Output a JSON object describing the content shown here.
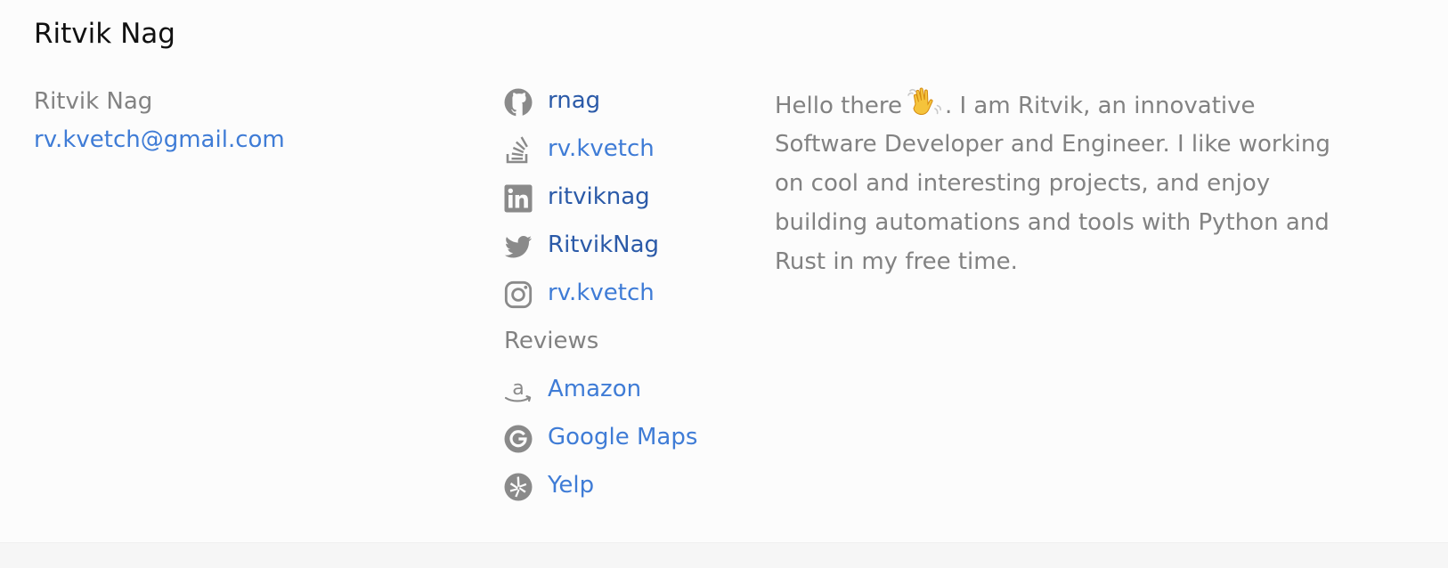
{
  "header": {
    "title": "Ritvik Nag"
  },
  "contact": {
    "name": "Ritvik Nag",
    "email": "rv.kvetch@gmail.com"
  },
  "social": [
    {
      "icon": "github-icon",
      "label": "rnag"
    },
    {
      "icon": "stackoverflow-icon",
      "label": "rv.kvetch"
    },
    {
      "icon": "linkedin-icon",
      "label": "ritviknag"
    },
    {
      "icon": "twitter-icon",
      "label": "RitvikNag"
    },
    {
      "icon": "instagram-icon",
      "label": "rv.kvetch"
    }
  ],
  "reviews": {
    "heading": "Reviews",
    "items": [
      {
        "icon": "amazon-icon",
        "label": "Amazon"
      },
      {
        "icon": "google-icon",
        "label": "Google Maps"
      },
      {
        "icon": "yelp-icon",
        "label": "Yelp"
      }
    ]
  },
  "bio": {
    "lines": [
      "Hello there",
      ". I am Ritvik, an innovative",
      "Software Developer and Engineer. I like working",
      "on cool and interesting projects, and enjoy",
      "building automations and tools with Python and",
      "Rust in my free time."
    ],
    "emoji": "waving-hand-emoji"
  },
  "colors": {
    "link_dark": "#2b5aa8",
    "link_light": "#3f7cd6",
    "muted_text": "#828282",
    "icon_gray": "#8a8a8a"
  }
}
